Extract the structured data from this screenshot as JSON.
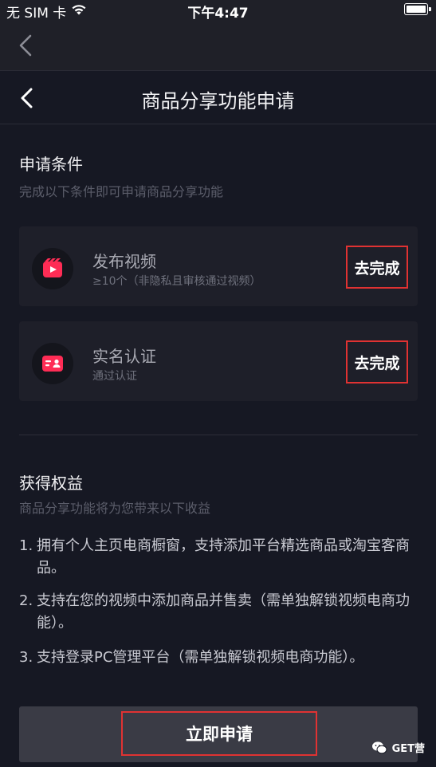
{
  "status_bar": {
    "carrier": "无 SIM 卡",
    "time": "下午4:47",
    "icons": [
      "wifi-icon",
      "battery-icon"
    ]
  },
  "header": {
    "title": "商品分享功能申请",
    "back_icon": "chevron-left-icon"
  },
  "conditions": {
    "title": "申请条件",
    "subtitle": "完成以下条件即可申请商品分享功能",
    "items": [
      {
        "icon": "video-clapper-icon",
        "title": "发布视频",
        "desc": "≥10个（非隐私且审核通过视频）",
        "action": "去完成"
      },
      {
        "icon": "id-card-icon",
        "title": "实名认证",
        "desc": "通过认证",
        "action": "去完成"
      }
    ]
  },
  "benefits": {
    "title": "获得权益",
    "subtitle": "商品分享功能将为您带来以下收益",
    "items": [
      {
        "num": "1.",
        "text": "拥有个人主页电商橱窗，支持添加平台精选商品或淘宝客商品。"
      },
      {
        "num": "2.",
        "text": "支持在您的视频中添加商品并售卖（需单独解锁视频电商功能）。"
      },
      {
        "num": "3.",
        "text": "支持登录PC管理平台（需单独解锁视频电商功能）。"
      }
    ]
  },
  "apply_button": "立即申请",
  "watermark": "GET营",
  "colors": {
    "background": "#161823",
    "card": "#1e1f29",
    "icon_accent": "#fe2c55",
    "highlight_box": "#e03232"
  }
}
